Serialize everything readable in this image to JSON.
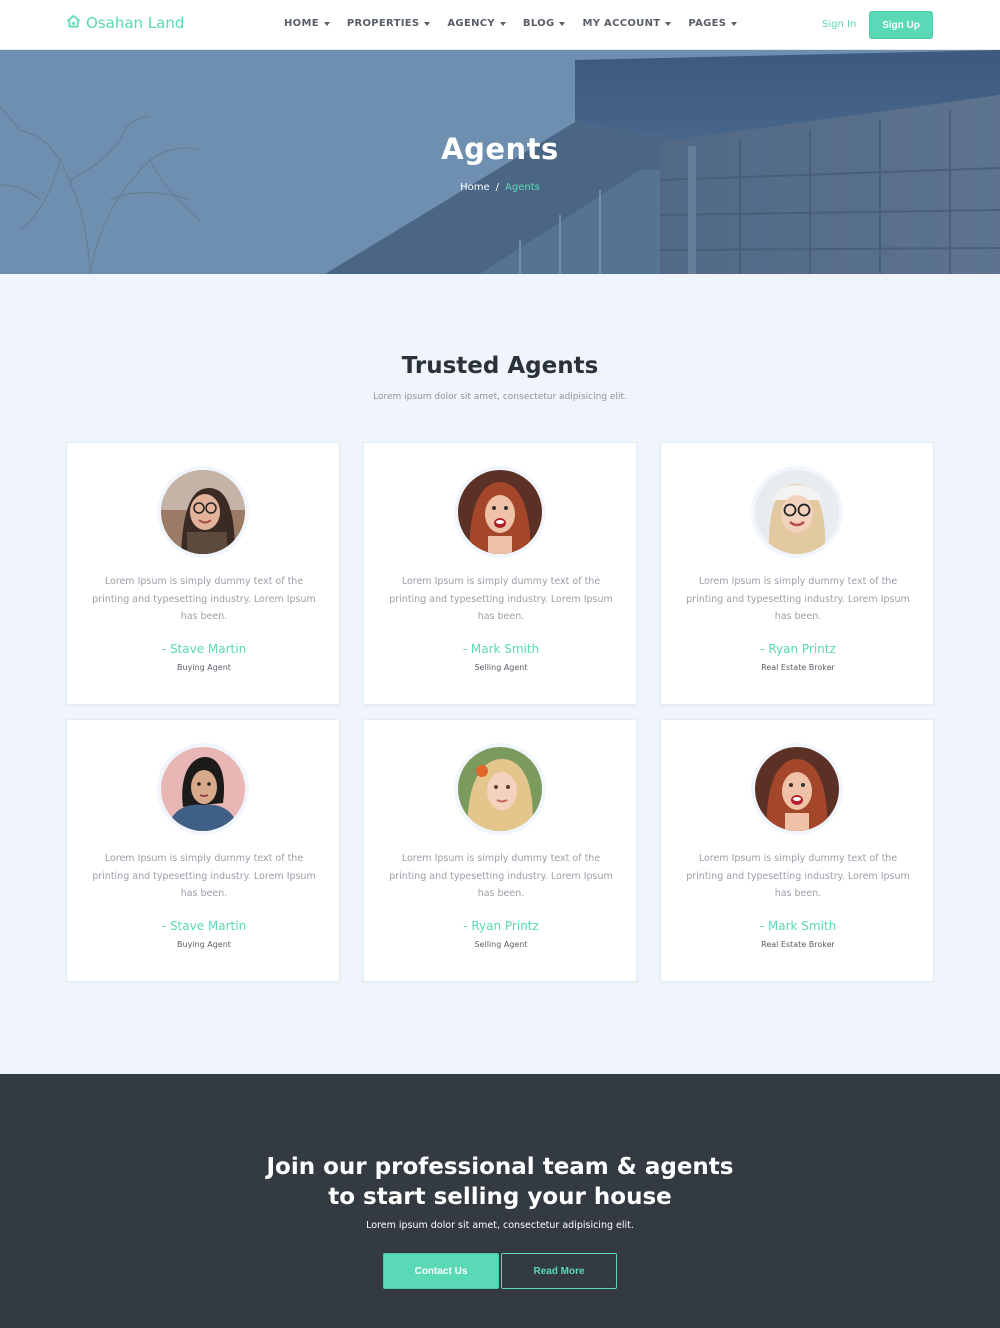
{
  "brand": {
    "name_part1": "Osahan",
    "name_part2": " Land",
    "icon": "home-icon"
  },
  "nav": {
    "items": [
      {
        "label": "HOME"
      },
      {
        "label": "PROPERTIES"
      },
      {
        "label": "AGENCY"
      },
      {
        "label": "BLOG"
      },
      {
        "label": "MY ACCOUNT"
      },
      {
        "label": "PAGES"
      }
    ],
    "sign_in": "Sign In",
    "sign_up": "Sign Up"
  },
  "hero": {
    "title": "Agents",
    "breadcrumb": {
      "home": "Home",
      "separator": "/",
      "current": "Agents"
    }
  },
  "section": {
    "title": "Trusted Agents",
    "subtitle": "Lorem ipsum dolor sit amet, consectetur adipisicing elit."
  },
  "agents": [
    {
      "text": "Lorem Ipsum is simply dummy text of the printing and typesetting industry. Lorem Ipsum has been.",
      "name": "- Stave Martin",
      "role": "Buying Agent"
    },
    {
      "text": "Lorem Ipsum is simply dummy text of the printing and typesetting industry. Lorem Ipsum has been.",
      "name": "- Mark Smith",
      "role": "Selling Agent"
    },
    {
      "text": "Lorem Ipsum is simply dummy text of the printing and typesetting industry. Lorem Ipsum has been.",
      "name": "- Ryan Printz",
      "role": "Real Estate Broker"
    },
    {
      "text": "Lorem Ipsum is simply dummy text of the printing and typesetting industry. Lorem Ipsum has been.",
      "name": "- Stave Martin",
      "role": "Buying Agent"
    },
    {
      "text": "Lorem Ipsum is simply dummy text of the printing and typesetting industry. Lorem Ipsum has been.",
      "name": "- Ryan Printz",
      "role": "Selling Agent"
    },
    {
      "text": "Lorem Ipsum is simply dummy text of the printing and typesetting industry. Lorem Ipsum has been.",
      "name": "- Mark Smith",
      "role": "Real Estate Broker"
    }
  ],
  "cta": {
    "title_line1": "Join our professional team & agents",
    "title_line2": "to start selling your house",
    "subtitle": "Lorem ipsum dolor sit amet, consectetur adipisicing elit.",
    "contact_button": "Contact Us",
    "read_more_button": "Read More"
  },
  "colors": {
    "accent": "#59d9b5",
    "page_background": "#f0f5fd",
    "footer_background": "#343a41",
    "heading": "#2a3139"
  }
}
